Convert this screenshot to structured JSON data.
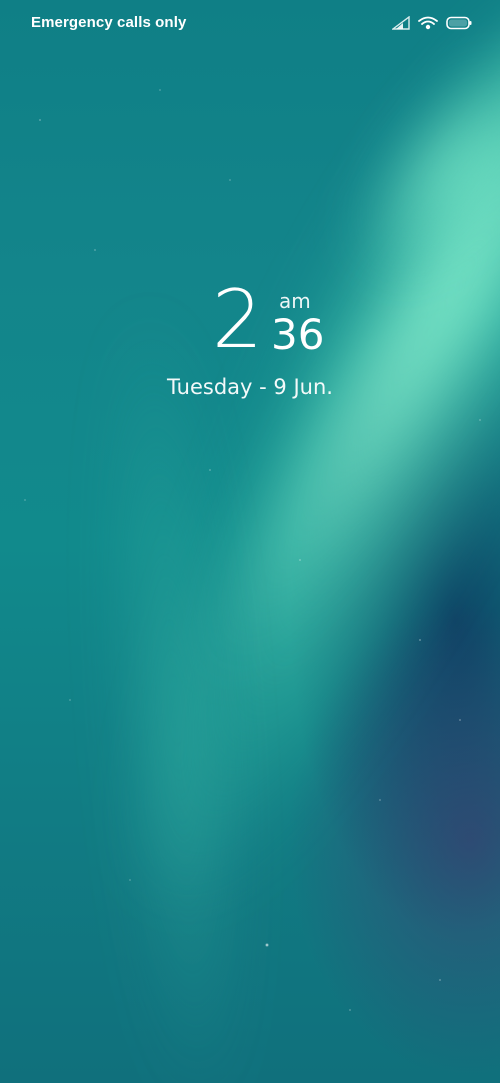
{
  "status_bar": {
    "carrier_text": "Emergency calls only",
    "icons": [
      "signal-icon",
      "wifi-icon",
      "battery-icon"
    ]
  },
  "clock": {
    "hour": "2",
    "minutes": "36",
    "period": "am"
  },
  "date": {
    "text": "Tuesday - 9 Jun."
  },
  "colors": {
    "text": "#ffffff",
    "wallpaper_teal": "#118a8c",
    "aurora_green": "#6ef0c8"
  }
}
